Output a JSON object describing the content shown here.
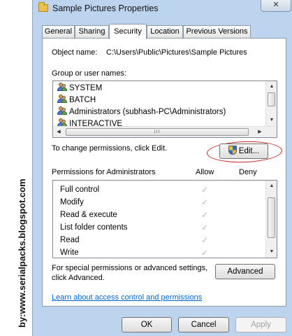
{
  "watermark": "by:www.serialpacks.blogspot.com",
  "window": {
    "title": "Sample Pictures Properties",
    "close_label": "✕"
  },
  "tabs": [
    {
      "label": "General"
    },
    {
      "label": "Sharing"
    },
    {
      "label": "Security",
      "active": true
    },
    {
      "label": "Location"
    },
    {
      "label": "Previous Versions"
    }
  ],
  "security": {
    "object_name_label": "Object name:",
    "object_name_value": "C:\\Users\\Public\\Pictures\\Sample Pictures",
    "group_label": "Group or user names:",
    "users": [
      {
        "name": "SYSTEM",
        "icon": "user-group-icon"
      },
      {
        "name": "BATCH",
        "icon": "user-group-icon"
      },
      {
        "name": "Administrators (subhash-PC\\Administrators)",
        "icon": "user-group-icon"
      },
      {
        "name": "INTERACTIVE",
        "icon": "user-group-icon"
      }
    ],
    "hscroll_grip": "III",
    "change_perm_text": "To change permissions, click Edit.",
    "edit_button": "Edit...",
    "permissions_for": "Permissions for Administrators",
    "allow_header": "Allow",
    "deny_header": "Deny",
    "permissions": [
      {
        "name": "Full control",
        "allow": true,
        "deny": false
      },
      {
        "name": "Modify",
        "allow": true,
        "deny": false
      },
      {
        "name": "Read & execute",
        "allow": true,
        "deny": false
      },
      {
        "name": "List folder contents",
        "allow": true,
        "deny": false
      },
      {
        "name": "Read",
        "allow": true,
        "deny": false
      },
      {
        "name": "Write",
        "allow": true,
        "deny": false
      }
    ],
    "special_text_1": "For special permissions or advanced settings,",
    "special_text_2": "click Advanced.",
    "advanced_button": "Advanced",
    "learn_link": "Learn about access control and permissions"
  },
  "footer": {
    "ok": "OK",
    "cancel": "Cancel",
    "apply": "Apply"
  },
  "colors": {
    "window_frame": "#bcd4ee",
    "annotation_ellipse": "#c4262a",
    "link": "#0066cc"
  }
}
